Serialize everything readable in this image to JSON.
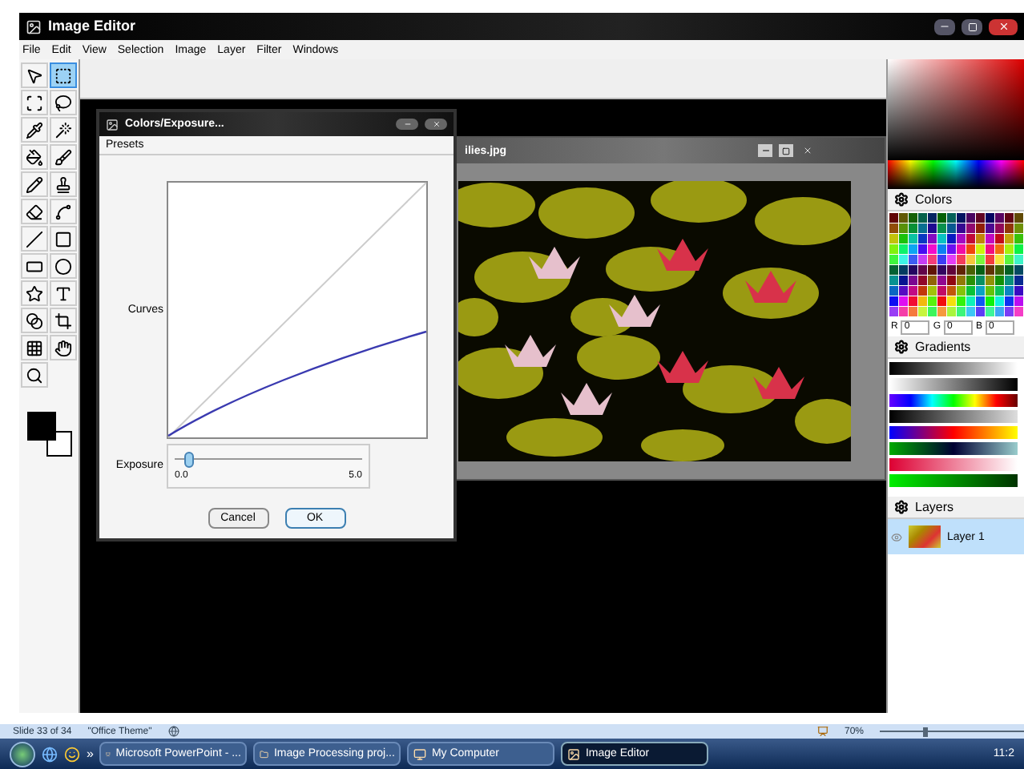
{
  "window": {
    "title": "Image Editor"
  },
  "menu": [
    "File",
    "Edit",
    "View",
    "Selection",
    "Image",
    "Layer",
    "Filter",
    "Windows"
  ],
  "tools": [
    {
      "selected": false
    },
    {
      "selected": true
    },
    {
      "selected": false
    },
    {
      "selected": false
    },
    {
      "selected": false
    },
    {
      "selected": false
    },
    {
      "selected": false
    },
    {
      "selected": false
    },
    {
      "selected": false
    },
    {
      "selected": false
    },
    {
      "selected": false
    },
    {
      "selected": false
    },
    {
      "selected": false
    },
    {
      "selected": false
    },
    {
      "selected": false
    },
    {
      "selected": false
    },
    {
      "selected": false
    },
    {
      "selected": false
    },
    {
      "selected": false
    },
    {
      "selected": false
    },
    {
      "selected": false
    },
    {
      "selected": false
    },
    {
      "selected": false
    }
  ],
  "image_window": {
    "title": "ilies.jpg"
  },
  "dialog": {
    "title": "Colors/Exposure...",
    "menu": [
      "Presets"
    ],
    "curves_label": "Curves",
    "exposure": {
      "label": "Exposure",
      "level": 0.08,
      "min": "0.0",
      "max": "5.0"
    },
    "buttons": [
      {
        "label": "Cancel",
        "selected": false
      },
      {
        "label": "OK",
        "selected": true
      }
    ]
  },
  "panels": {
    "colors": {
      "title": "Colors",
      "fields": [
        {
          "label": "R",
          "value": "0"
        },
        {
          "label": "G",
          "value": "0"
        },
        {
          "label": "B",
          "value": "0"
        }
      ]
    },
    "gradients": {
      "title": "Gradients"
    },
    "layers": {
      "title": "Layers",
      "items": [
        {
          "name": "Layer 1",
          "selected": true
        }
      ]
    }
  },
  "status_bar": {
    "slide": "Slide 33 of 34",
    "theme": "\"Office Theme\"",
    "zoom": "70%",
    "zoom_slider": {
      "level": 0.3
    }
  },
  "taskbar": {
    "overflow": "»",
    "tasks": [
      {
        "label": "Microsoft PowerPoint - ...",
        "selected": false
      },
      {
        "label": "Image Processing proj...",
        "selected": false
      },
      {
        "label": "My Computer",
        "selected": false
      },
      {
        "label": "Image Editor",
        "selected": true
      }
    ],
    "clock": "11:2"
  }
}
